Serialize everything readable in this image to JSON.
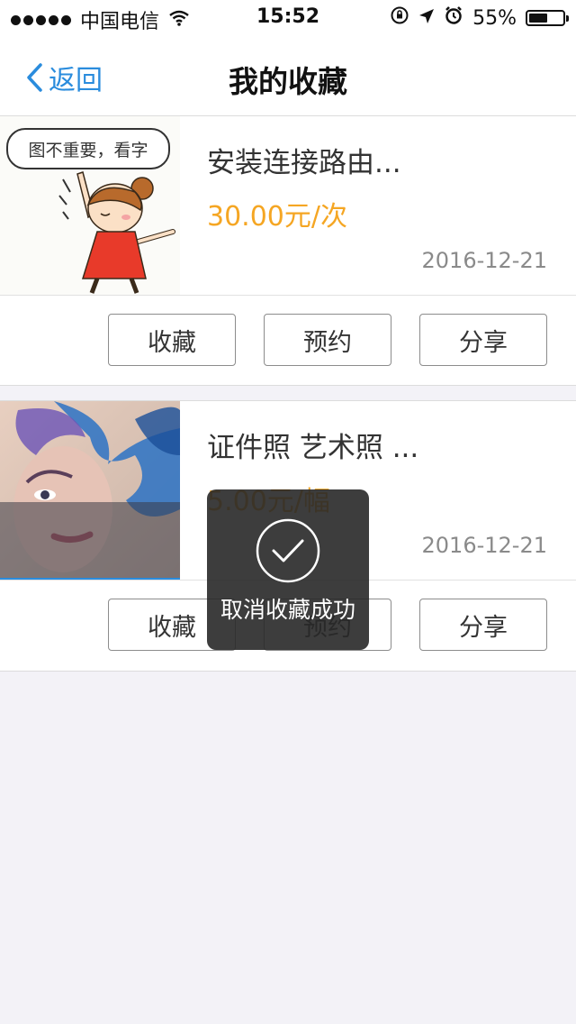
{
  "status_bar": {
    "carrier": "中国电信",
    "time": "15:52",
    "battery": "55%",
    "battery_level": 0.55
  },
  "nav": {
    "back_label": "返回",
    "title": "我的收藏"
  },
  "items": [
    {
      "thumb_caption": "图不重要，看字",
      "title": "安装连接路由...",
      "price": "30.00元/次",
      "date": "2016-12-21",
      "buttons": [
        "收藏",
        "预约",
        "分享"
      ]
    },
    {
      "title": "证件照 艺术照 ...",
      "price": "5.00元/幅",
      "date": "2016-12-21",
      "buttons": [
        "收藏",
        "预约",
        "分享"
      ]
    }
  ],
  "toast": {
    "message": "取消收藏成功"
  },
  "colors": {
    "accent": "#2a8cdd",
    "price": "#f5a623",
    "toast_bg": "#282828",
    "page_bg": "#f3f2f7"
  }
}
